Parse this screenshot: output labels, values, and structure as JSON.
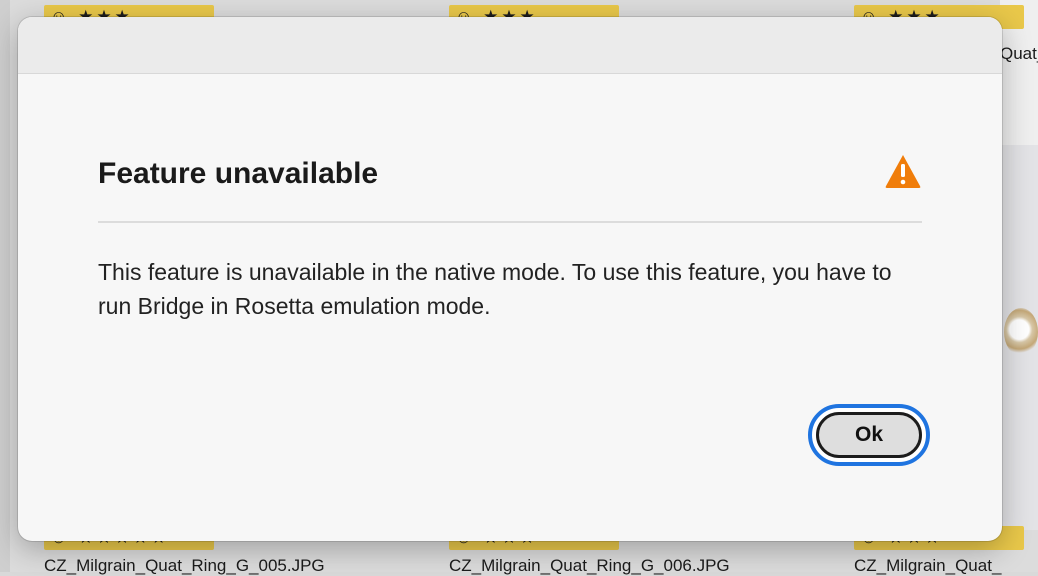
{
  "background": {
    "ratings_top": [
      "☺ ★★★",
      "☺ ★★★",
      "☺ ★★★"
    ],
    "ratings_bottom": [
      "☺ ★★★★★",
      "☺ ★★★",
      "☺ ★★★"
    ],
    "captions": [
      "CZ_Milgrain_Quat_Ring_G_005.JPG",
      "CZ_Milgrain_Quat_Ring_G_006.JPG",
      "CZ_Milgrain_Quat_"
    ],
    "right_clipped_caption": "Quat_"
  },
  "dialog": {
    "title": "Feature unavailable",
    "icon": "warning-icon",
    "message": "This feature is unavailable in the native mode. To use this feature, you have to run Bridge in Rosetta emulation mode.",
    "ok_label": "Ok"
  },
  "colors": {
    "warning": "#f07d0a",
    "focus_ring": "#1f74e0",
    "rating_bar": "#e9c84a"
  }
}
